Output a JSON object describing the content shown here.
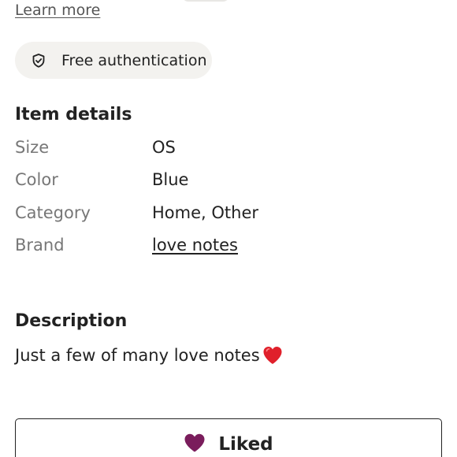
{
  "links": {
    "learn_more": "Learn more"
  },
  "authentication": {
    "label": "Free authentication",
    "icon": "shield-check-icon"
  },
  "item_details": {
    "title": "Item details",
    "rows": [
      {
        "key": "Size",
        "value": "OS"
      },
      {
        "key": "Color",
        "value": "Blue"
      },
      {
        "key": "Category",
        "value": "Home, Other"
      },
      {
        "key": "Brand",
        "value": "love notes"
      }
    ]
  },
  "description": {
    "title": "Description",
    "text": "Just a few of many love notes",
    "emoji_icon": "red-heart-icon"
  },
  "like_button": {
    "label": "Liked",
    "icon": "heart-icon",
    "heart_color": "#7a1d5c"
  },
  "colors": {
    "text": "#222222",
    "muted": "#777777",
    "badge_bg": "#f3f2ef",
    "heart_red": "#e0202b",
    "liked_heart": "#7a1d5c"
  }
}
